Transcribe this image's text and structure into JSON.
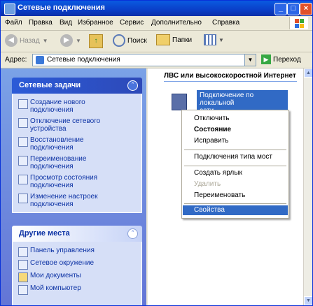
{
  "window": {
    "title": "Сетевые подключения",
    "buttons": {
      "minimize": "_",
      "maximize": "□",
      "close": "×"
    }
  },
  "menubar": [
    "Файл",
    "Правка",
    "Вид",
    "Избранное",
    "Сервис",
    "Дополнительно",
    "Справка"
  ],
  "toolbar": {
    "back": "Назад",
    "search": "Поиск",
    "folders": "Папки"
  },
  "address": {
    "label": "Адрес:",
    "value": "Сетевые подключения",
    "go": "Переход"
  },
  "left_pane": {
    "network_tasks": {
      "title": "Сетевые задачи",
      "items": [
        {
          "line1": "Создание нового",
          "line2": "подключения",
          "icon": "new-connection-icon"
        },
        {
          "line1": "Отключение сетевого",
          "line2": "устройства",
          "icon": "disable-device-icon"
        },
        {
          "line1": "Восстановление",
          "line2": "подключения",
          "icon": "repair-icon"
        },
        {
          "line1": "Переименование",
          "line2": "подключения",
          "icon": "rename-icon"
        },
        {
          "line1": "Просмотр состояния",
          "line2": "подключения",
          "icon": "status-icon"
        },
        {
          "line1": "Изменение настроек",
          "line2": "подключения",
          "icon": "settings-icon"
        }
      ]
    },
    "other_places": {
      "title": "Другие места",
      "items": [
        {
          "label": "Панель управления",
          "icon": "control-panel-icon"
        },
        {
          "label": "Сетевое окружение",
          "icon": "network-places-icon"
        },
        {
          "label": "Мои документы",
          "icon": "my-documents-icon"
        },
        {
          "label": "Мой компьютер",
          "icon": "my-computer-icon"
        }
      ]
    }
  },
  "content": {
    "group_header": "ЛВС или высокоскоростной Интернет",
    "connection": {
      "line1": "Подключение по локальной",
      "line2": "сети"
    }
  },
  "context_menu": {
    "items": [
      {
        "label": "Отключить",
        "style": "normal"
      },
      {
        "label": "Состояние",
        "style": "bold"
      },
      {
        "label": "Исправить",
        "style": "normal"
      },
      {
        "label": "Подключения типа мост",
        "style": "normal"
      },
      {
        "label": "Создать ярлык",
        "style": "normal"
      },
      {
        "label": "Удалить",
        "style": "disabled"
      },
      {
        "label": "Переименовать",
        "style": "normal"
      },
      {
        "label": "Свойства",
        "style": "selected"
      }
    ]
  },
  "colors": {
    "titlebar": "#0a3fc8",
    "task_pane": "#6375d6",
    "selection": "#316ac5"
  }
}
